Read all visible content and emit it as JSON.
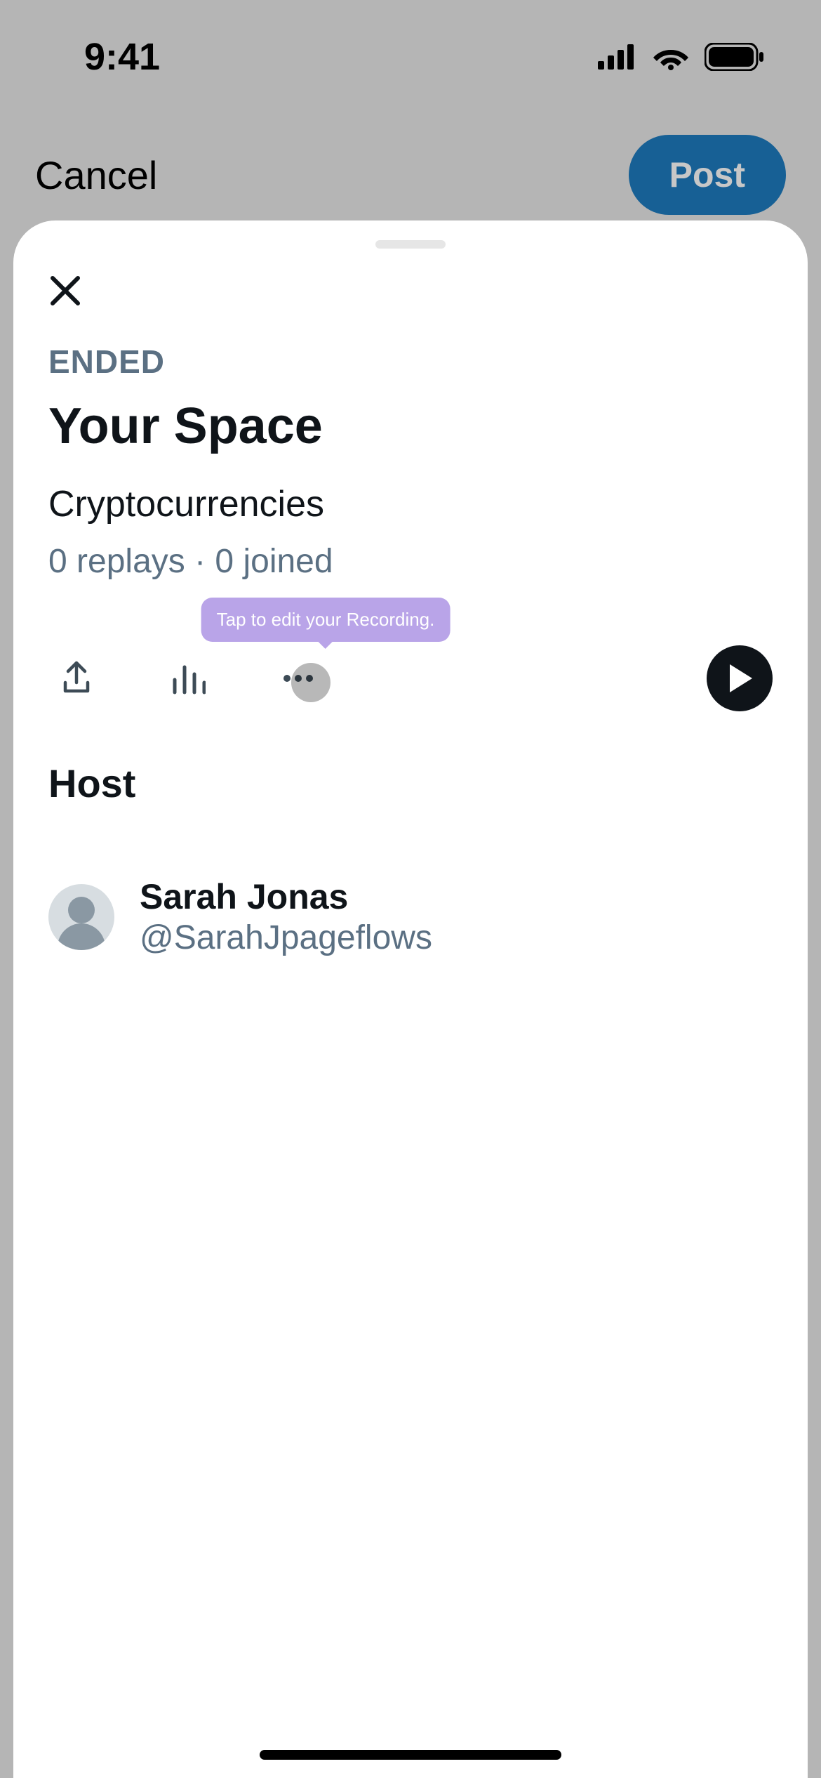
{
  "status_bar": {
    "time": "9:41"
  },
  "compose": {
    "cancel": "Cancel",
    "post": "Post"
  },
  "sheet": {
    "status": "ENDED",
    "title": "Your Space",
    "topic": "Cryptocurrencies",
    "meta": "0 replays · 0 joined",
    "tooltip": "Tap to edit your Recording.",
    "host_section": "Host",
    "host": {
      "name": "Sarah Jonas",
      "handle": "@SarahJpageflows"
    }
  }
}
